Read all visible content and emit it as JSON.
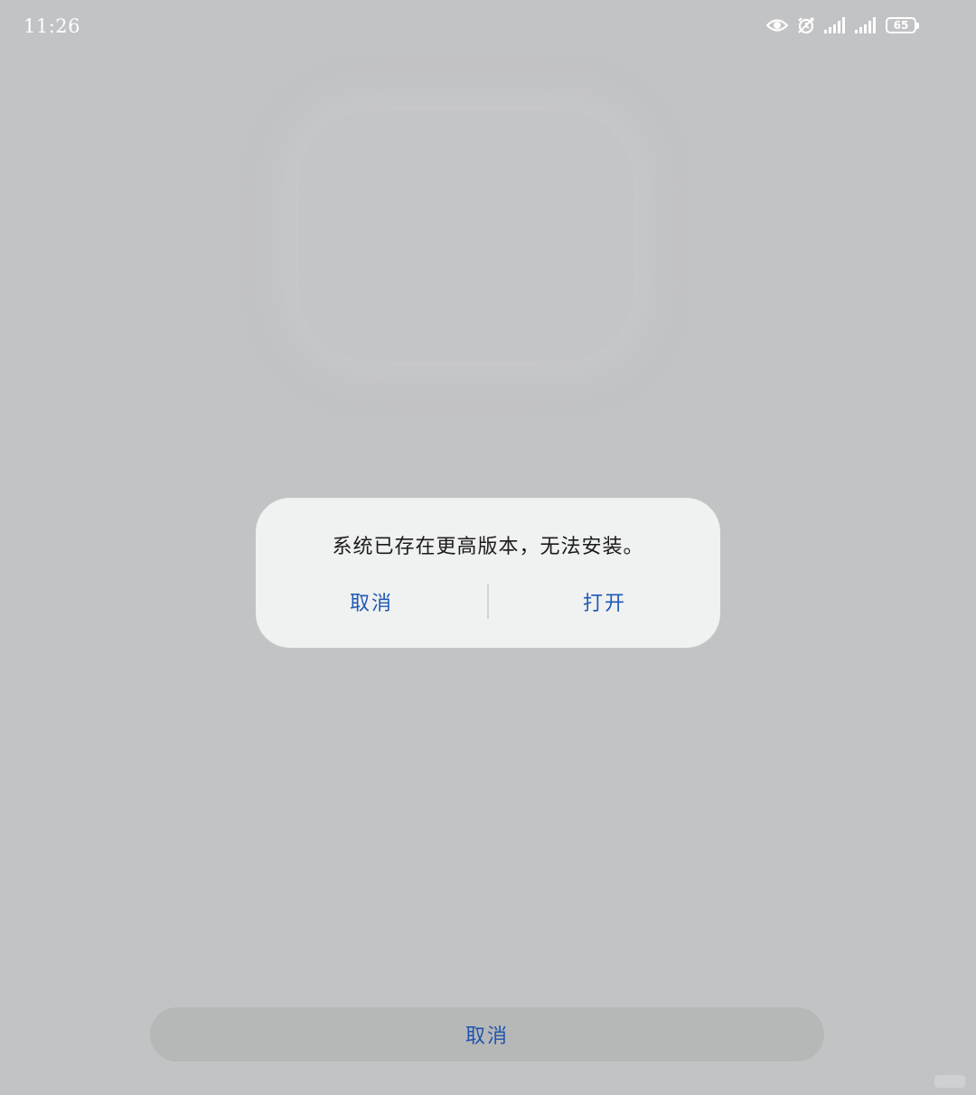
{
  "status_bar": {
    "time": "11:26",
    "icons": [
      "eye-icon",
      "alarm-icon",
      "signal-icon",
      "signal-icon"
    ],
    "battery": "65",
    "icon_color": "#ffffff"
  },
  "dialog": {
    "message": "系统已存在更高版本，无法安装。",
    "cancel_label": "取消",
    "open_label": "打开",
    "accent_color": "#1e5ab4"
  },
  "bottom_sheet": {
    "cancel_label": "取消"
  }
}
